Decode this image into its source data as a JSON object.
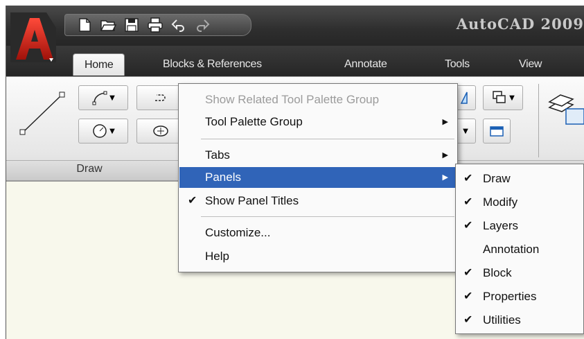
{
  "window": {
    "title": "AutoCAD 2009"
  },
  "colors": {
    "brand_red": "#d4261b",
    "menu_highlight": "#3064b8",
    "disabled_text": "#9b9b9b"
  },
  "quick_access": [
    {
      "icon": "new-file-icon"
    },
    {
      "icon": "open-folder-icon"
    },
    {
      "icon": "save-icon"
    },
    {
      "icon": "print-icon"
    },
    {
      "icon": "undo-icon"
    },
    {
      "icon": "redo-icon"
    }
  ],
  "tabs": [
    "Home",
    "Blocks & References",
    "Annotate",
    "Tools",
    "View"
  ],
  "active_tab": "Home",
  "ribbon": {
    "draw_panel_title": "Draw"
  },
  "context_menu": {
    "items": [
      {
        "label": "Show Related Tool Palette Group",
        "disabled": true
      },
      {
        "label": "Tool Palette Group",
        "submenu": true
      },
      {
        "label": "Tabs",
        "submenu": true
      },
      {
        "label": "Panels",
        "submenu": true,
        "highlighted": true
      },
      {
        "label": "Show Panel Titles",
        "checked": true
      },
      {
        "label": "Customize..."
      },
      {
        "label": "Help"
      }
    ]
  },
  "panels_submenu": {
    "items": [
      {
        "label": "Draw",
        "checked": true
      },
      {
        "label": "Modify",
        "checked": true
      },
      {
        "label": "Layers",
        "checked": true
      },
      {
        "label": "Annotation",
        "checked": false
      },
      {
        "label": "Block",
        "checked": true
      },
      {
        "label": "Properties",
        "checked": true
      },
      {
        "label": "Utilities",
        "checked": true
      }
    ]
  },
  "glyphs": {
    "check": "✔",
    "submenu_arrow": "▶",
    "caret": "▼"
  }
}
